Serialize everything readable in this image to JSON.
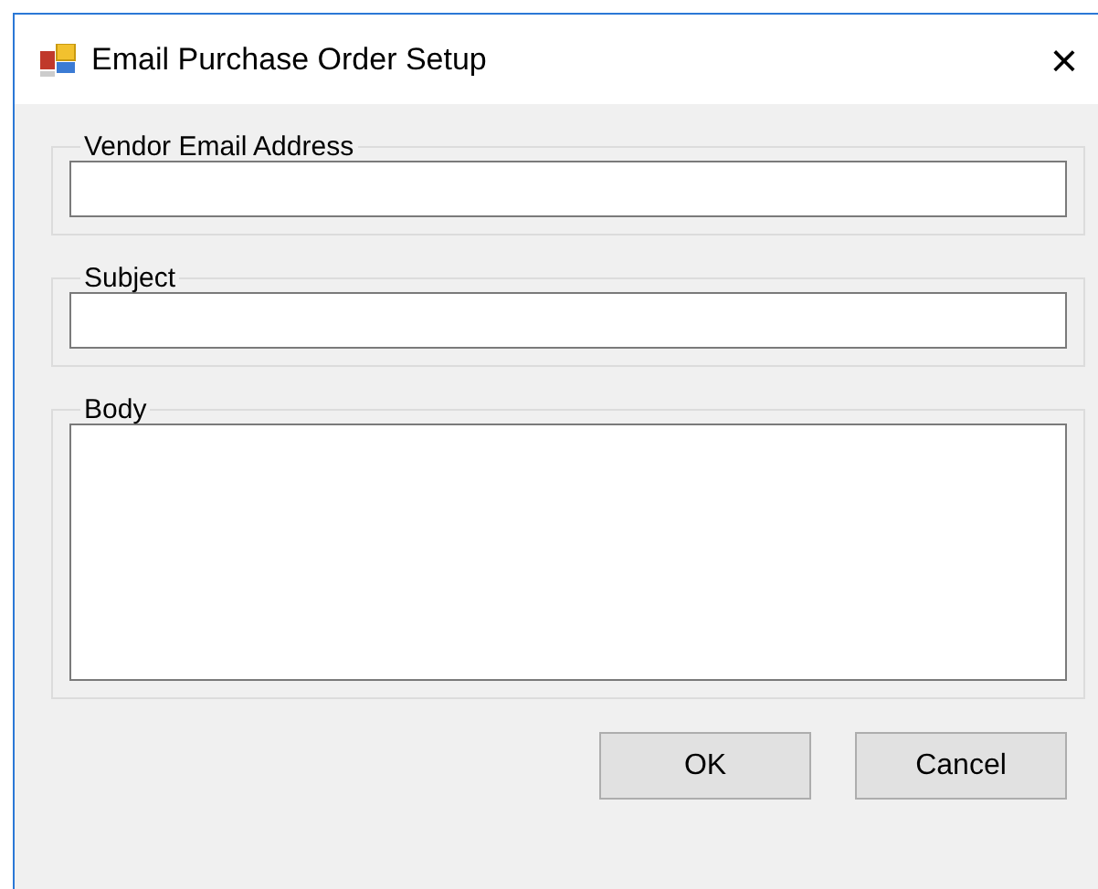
{
  "window": {
    "title": "Email Purchase Order Setup",
    "close": "×"
  },
  "groups": [
    {
      "label": "Vendor Email Address",
      "kind": "line"
    },
    {
      "label": "Subject",
      "kind": "line"
    },
    {
      "label": "Body",
      "kind": "multiline"
    }
  ],
  "buttons": [
    "OK",
    "Cancel"
  ]
}
